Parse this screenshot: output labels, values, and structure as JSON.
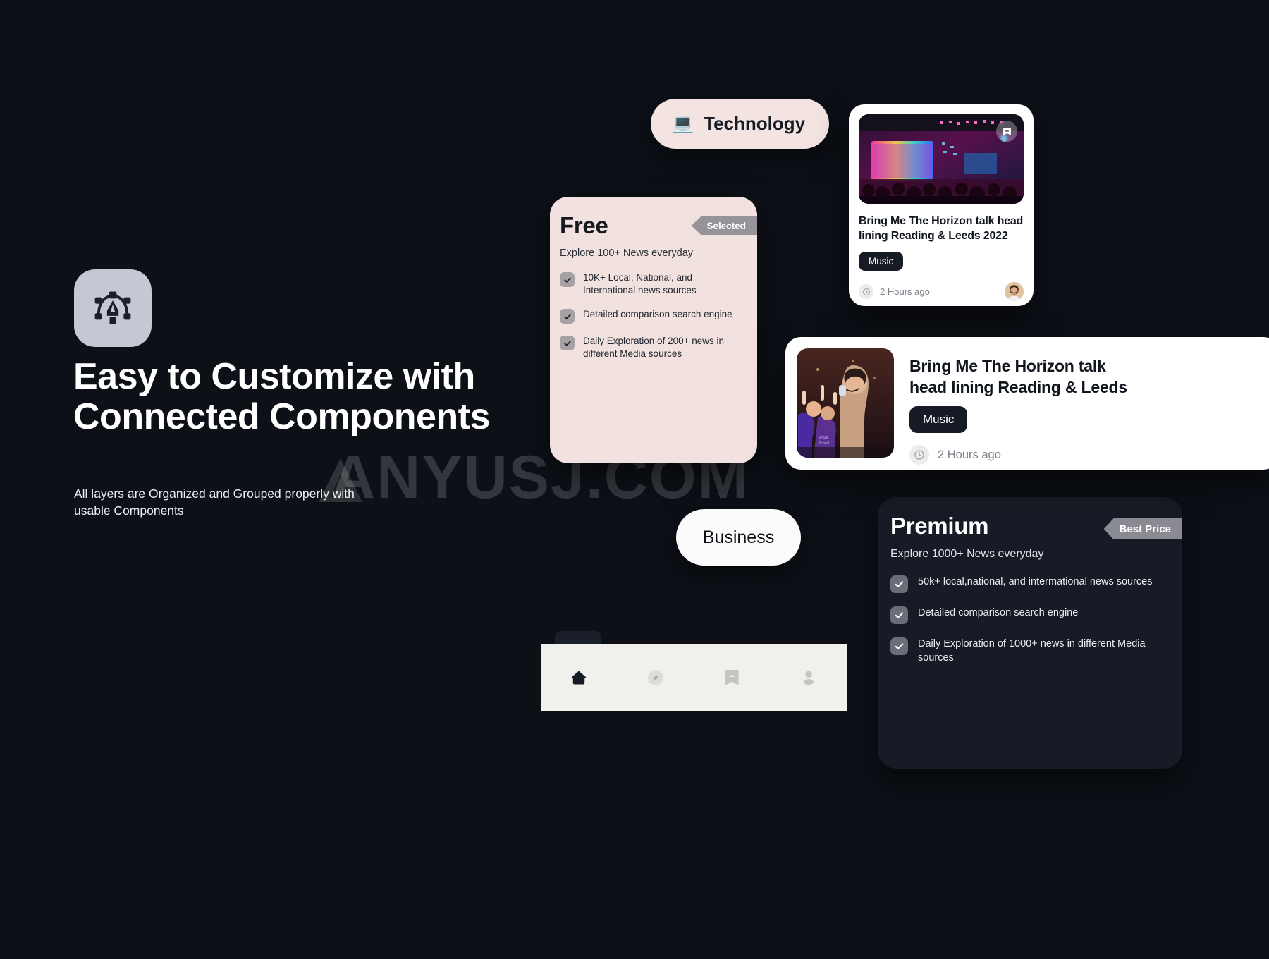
{
  "page": {
    "background_color": "#0d1017",
    "watermark": "ANYUSJ.COM"
  },
  "hero": {
    "icon": "pen-tool-icon",
    "title": "Easy to Customize with Connected Components",
    "subtitle": "All layers are Organized and Grouped properly with usable Components"
  },
  "chips": {
    "technology": {
      "emoji": "💻",
      "label": "Technology"
    },
    "business": {
      "label": "Business"
    }
  },
  "plans": [
    {
      "id": "free",
      "name": "Free",
      "badge": "Selected",
      "subtitle": "Explore 100+ News everyday",
      "features": [
        "10K+ Local, National, and International news sources",
        "Detailed comparison search engine",
        "Daily Exploration of 200+ news in different Media sources"
      ],
      "card_color": "#f2e2df",
      "badge_color": "#96939a"
    },
    {
      "id": "premium",
      "name": "Premium",
      "badge": "Best Price",
      "subtitle": "Explore 1000+ News everyday",
      "features": [
        "50k+ local,national, and intermational news sources",
        "Detailed comparison search engine",
        "Daily Exploration of 1000+ news in different Media sources"
      ],
      "card_color": "#171b25",
      "badge_color": "#8a8a92"
    }
  ],
  "news_cards": [
    {
      "id": "vertical",
      "headline": "Bring Me The Horizon talk head lining Reading & Leeds 2022",
      "tag": "Music",
      "time": "2 Hours ago",
      "bookmark_icon": "bookmark-icon",
      "clock_icon": "clock-icon",
      "avatar": "user-avatar",
      "image_alt": "concert-stage-photo"
    },
    {
      "id": "horizontal",
      "headline_line1": "Bring Me The Horizon talk",
      "headline_line2": "head lining Reading & Leeds",
      "tag": "Music",
      "time": "2 Hours ago",
      "clock_icon": "clock-icon",
      "image_alt": "singer-crowd-photo"
    }
  ],
  "bottom_nav": {
    "background_color": "#f0f0ec",
    "items": [
      {
        "icon": "home-icon",
        "active": true
      },
      {
        "icon": "compass-icon",
        "active": false
      },
      {
        "icon": "bookmark-icon",
        "active": false
      },
      {
        "icon": "profile-icon",
        "active": false
      }
    ]
  }
}
